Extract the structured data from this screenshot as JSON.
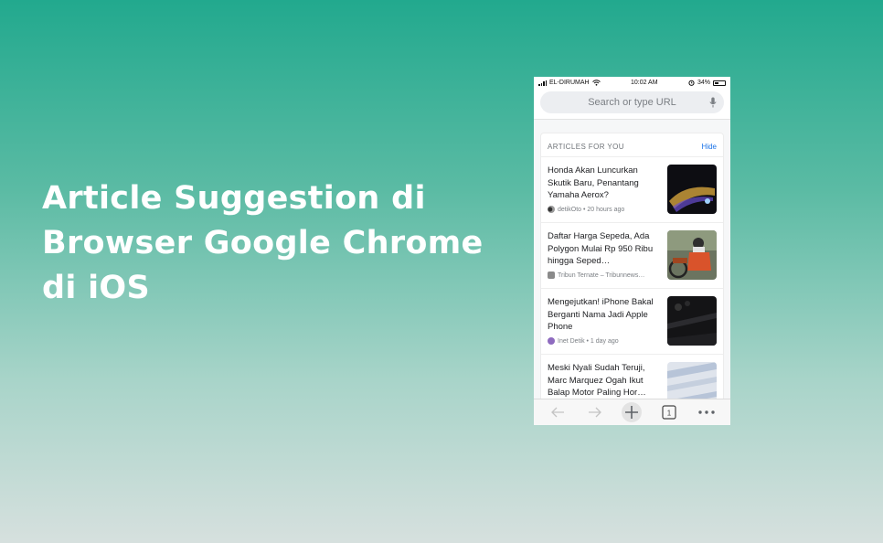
{
  "headline": {
    "line1": "Article Suggestion di",
    "line2": "Browser Google Chrome",
    "line3": "di iOS"
  },
  "status_bar": {
    "carrier": "EL-DIRUMAH",
    "time": "10:02 AM",
    "battery": "34%"
  },
  "search": {
    "placeholder": "Search or type URL"
  },
  "articles_section": {
    "title": "ARTICLES FOR YOU",
    "hide_label": "Hide",
    "items": [
      {
        "title": "Honda Akan Luncurkan Skutik Baru, Penantang Yamaha Aerox?",
        "source": "detikOto • 20 hours ago"
      },
      {
        "title": "Daftar Harga Sepeda, Ada Polygon Mulai Rp 950 Ribu hingga Seped…",
        "source": "Tribun Ternate – Tribunnews…"
      },
      {
        "title": "Mengejutkan! iPhone Bakal Berganti Nama Jadi Apple Phone",
        "source": "Inet Detik • 1 day ago"
      },
      {
        "title": "Meski Nyali Sudah Teruji, Marc Marquez Ogah Ikut Balap Motor Paling Hor…",
        "source": ""
      }
    ]
  },
  "toolbar": {
    "tab_count": "1"
  },
  "icons": {
    "back": "back-arrow-icon",
    "forward": "forward-arrow-icon",
    "new_tab": "plus-icon",
    "tabs": "tab-switcher-icon",
    "menu": "more-dots-icon",
    "mic": "microphone-icon"
  },
  "colors": {
    "accent": "#1a73e8",
    "background_top": "#22a98e"
  }
}
